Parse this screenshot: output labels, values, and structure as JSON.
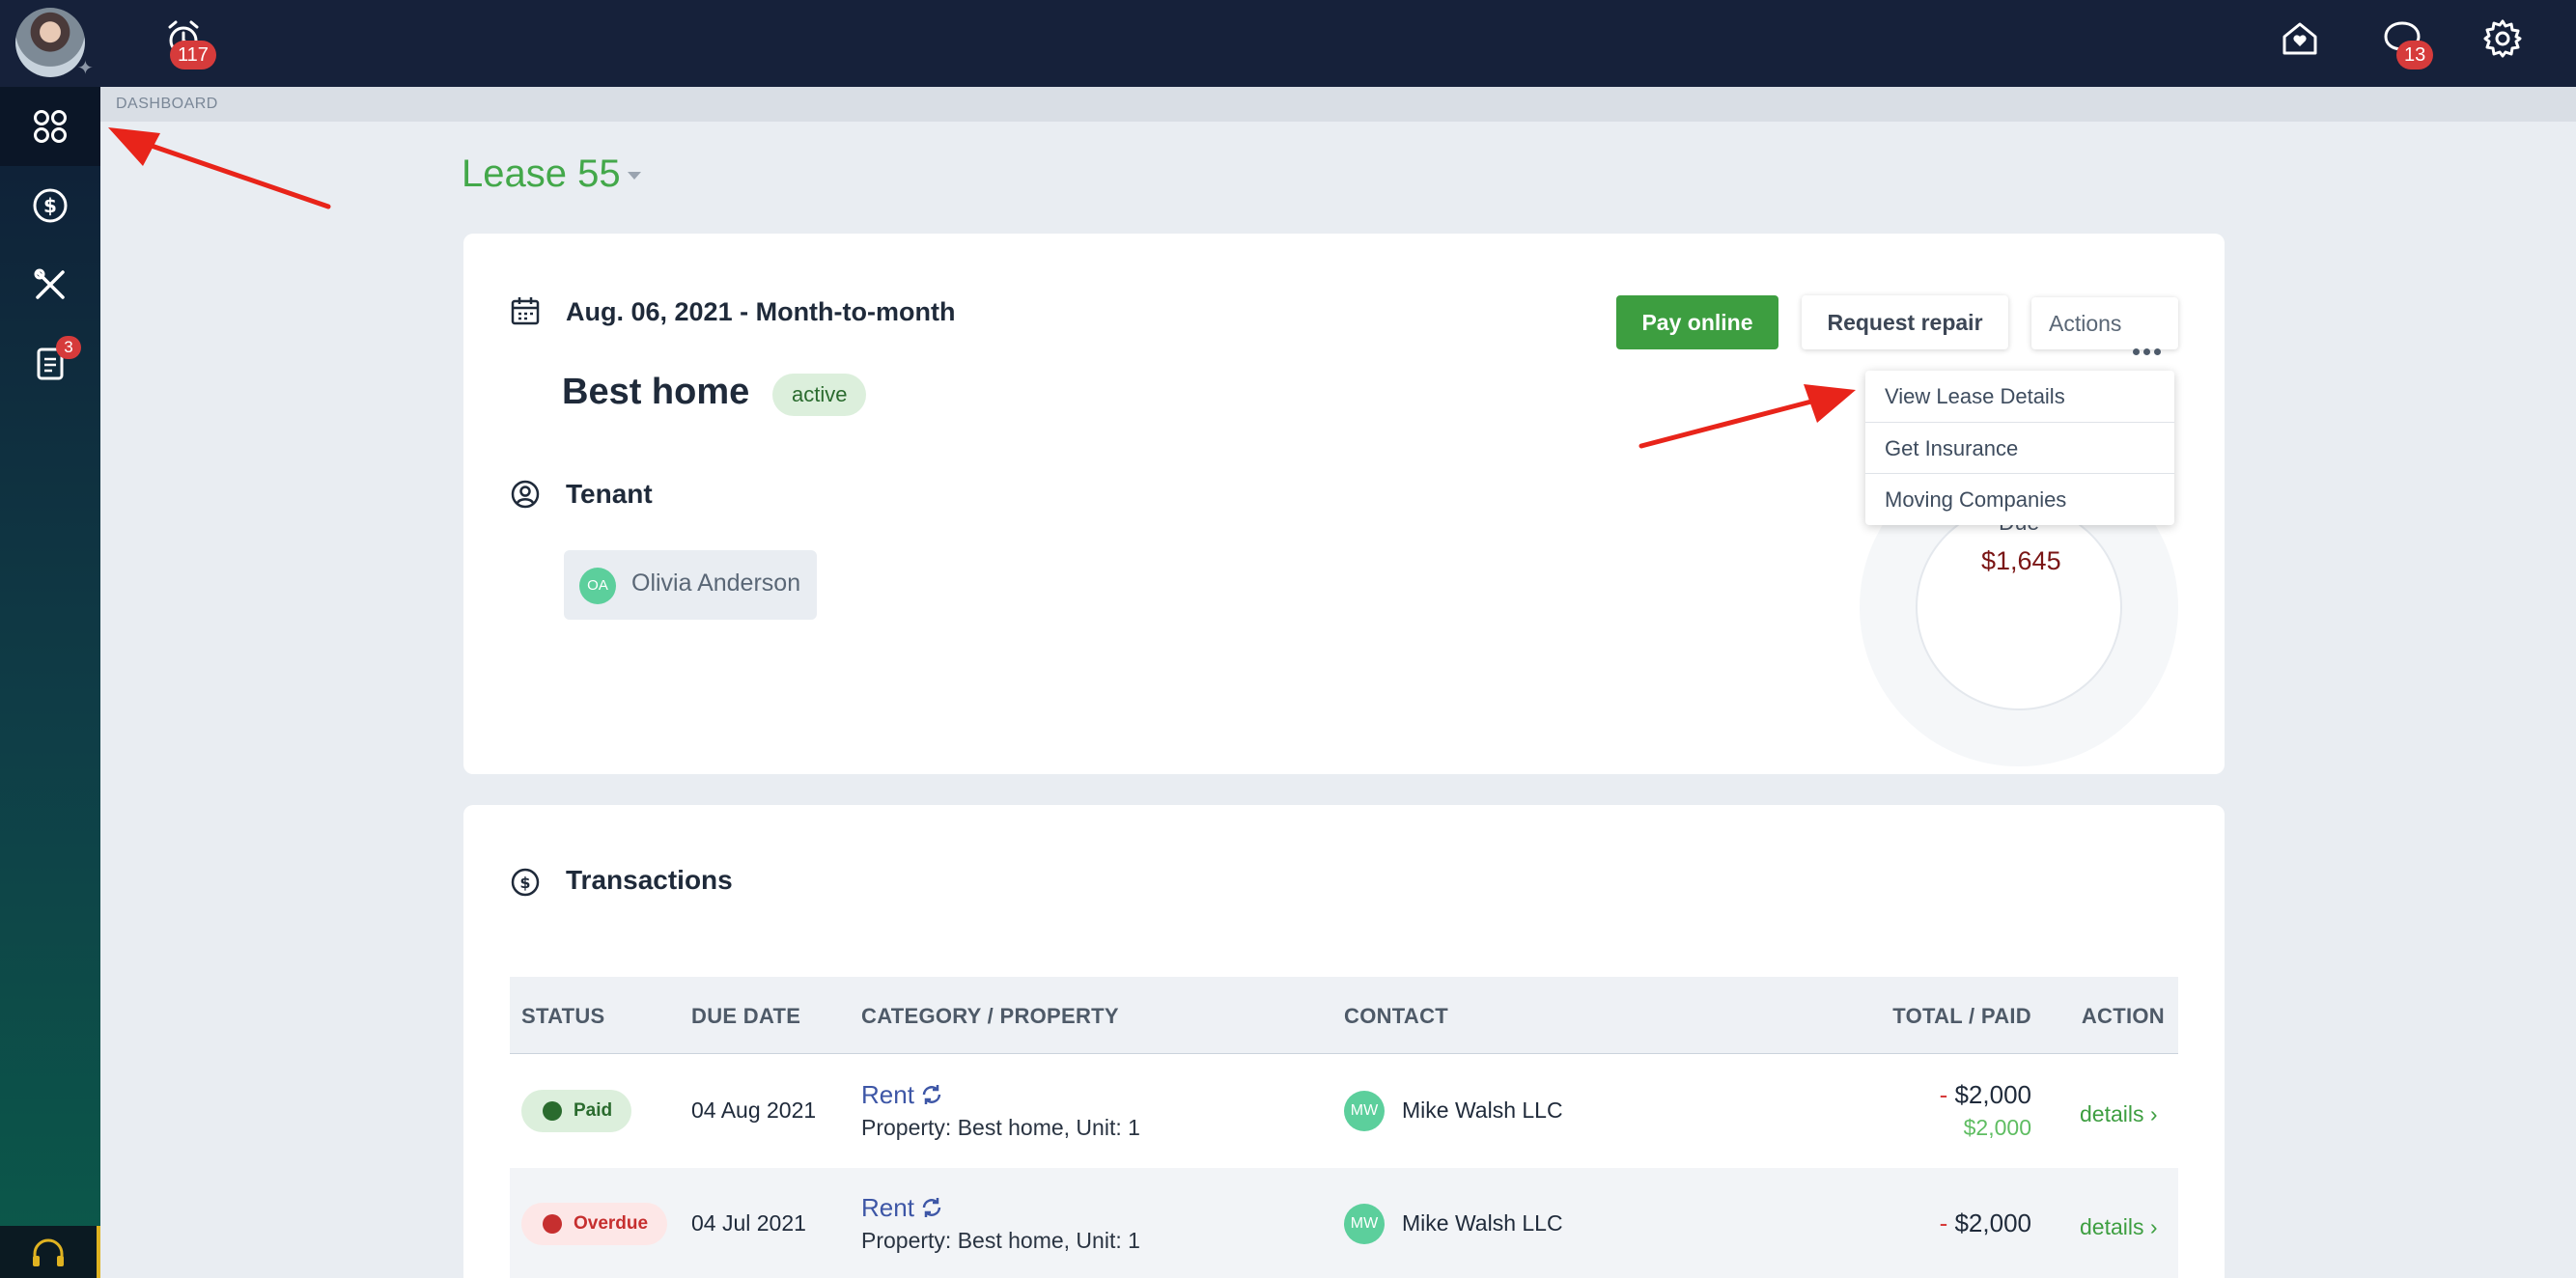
{
  "topbar": {
    "alarm_badge": "117",
    "notifications_badge": "13"
  },
  "sidebar": {
    "docs_badge": "3"
  },
  "breadcrumb": "DASHBOARD",
  "lease": {
    "title": "Lease 55",
    "date": "Aug. 06, 2021 - Month-to-month",
    "property": "Best home",
    "status": "active",
    "tenant_label": "Tenant",
    "tenant": {
      "initials": "OA",
      "name": "Olivia Anderson"
    },
    "due_label": "Due",
    "due_amount": "$1,645"
  },
  "buttons": {
    "pay": "Pay online",
    "repair": "Request repair",
    "actions": "Actions"
  },
  "actions_menu": [
    "View Lease Details",
    "Get Insurance",
    "Moving Companies"
  ],
  "transactions": {
    "title": "Transactions",
    "columns": [
      "STATUS",
      "DUE DATE",
      "CATEGORY / PROPERTY",
      "CONTACT",
      "TOTAL / PAID",
      "ACTION"
    ],
    "rows": [
      {
        "status": "Paid",
        "due_date": "04 Aug 2021",
        "category": "Rent",
        "property": "Property: Best home, Unit: 1",
        "contact_initials": "MW",
        "contact": "Mike Walsh LLC",
        "total": "$2,000",
        "paid": "$2,000",
        "action": "details ›"
      },
      {
        "status": "Overdue",
        "due_date": "04 Jul 2021",
        "category": "Rent",
        "property": "Property: Best home, Unit: 1",
        "contact_initials": "MW",
        "contact": "Mike Walsh LLC",
        "total": "$2,000",
        "action": "details ›"
      }
    ]
  },
  "colors": {
    "topbar": "#16213a",
    "accent_green": "#3d9e40",
    "link_blue": "#3d56a6",
    "badge_red": "#d63b3b",
    "due_amount": "#7a1515"
  }
}
